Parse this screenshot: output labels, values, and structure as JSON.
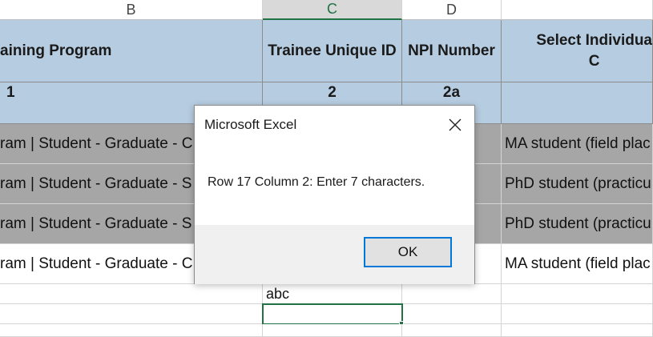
{
  "columns": {
    "b": "B",
    "c": "C",
    "d": "D"
  },
  "header_row": {
    "training_program": "aining Program",
    "trainee_unique_id": "Trainee Unique ID",
    "npi_number": "NPI Number",
    "select_individual": "Select Individua\nC"
  },
  "number_row": {
    "b": "1",
    "c": "2",
    "d": "2a",
    "e": ""
  },
  "rows": [
    {
      "b": "ram | Student - Graduate - C",
      "e": "MA student (field plac",
      "style": "gray"
    },
    {
      "b": "ram | Student - Graduate - S",
      "e": "PhD student (practicu",
      "style": "gray"
    },
    {
      "b": "ram | Student - Graduate - S",
      "e": "PhD student (practicu",
      "style": "gray"
    },
    {
      "b": "ram | Student - Graduate - C",
      "e": "MA student (field plac",
      "style": "white"
    }
  ],
  "entered_value": "abc",
  "dialog": {
    "title": "Microsoft Excel",
    "message": "Row 17 Column 2: Enter 7 characters.",
    "ok_label": "OK"
  },
  "colors": {
    "header_fill": "#b6cce0",
    "gray_fill": "#a6a6a6",
    "selection": "#217346",
    "focus": "#0078d7"
  }
}
